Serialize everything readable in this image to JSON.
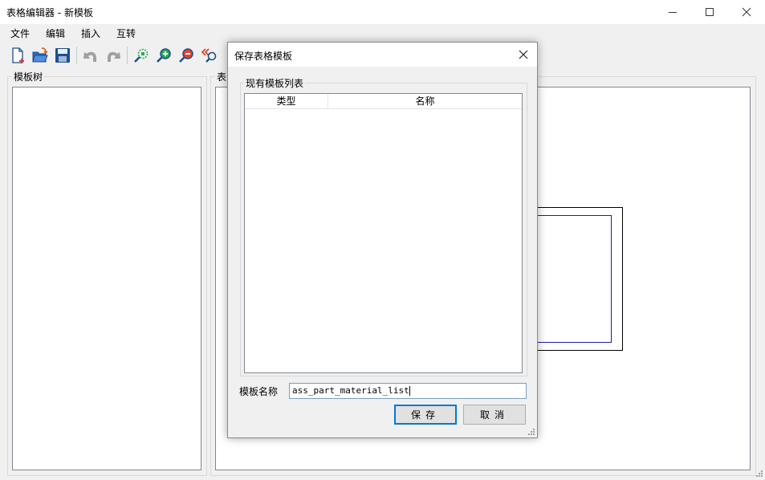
{
  "window": {
    "title": "表格编辑器 - 新模板"
  },
  "menu": {
    "items": [
      "文件",
      "编辑",
      "插入",
      "互转"
    ]
  },
  "toolbar": {
    "buttons": [
      "new-file-icon",
      "open-folder-icon",
      "save-icon",
      "undo-icon",
      "redo-icon",
      "zoom-fit-icon",
      "zoom-in-icon",
      "zoom-out-icon",
      "zoom-reset-icon"
    ]
  },
  "left_panel": {
    "label": "模板树"
  },
  "right_panel": {
    "label": "表"
  },
  "dialog": {
    "title": "保存表格模板",
    "group_label": "现有模板列表",
    "columns": [
      "类型",
      "名称"
    ],
    "name_label": "模板名称",
    "name_value": "ass_part_material_list",
    "save_label": "保存",
    "cancel_label": "取消"
  },
  "colors": {
    "accent": "#0078d7",
    "table_inner": "#1a1aa8"
  }
}
